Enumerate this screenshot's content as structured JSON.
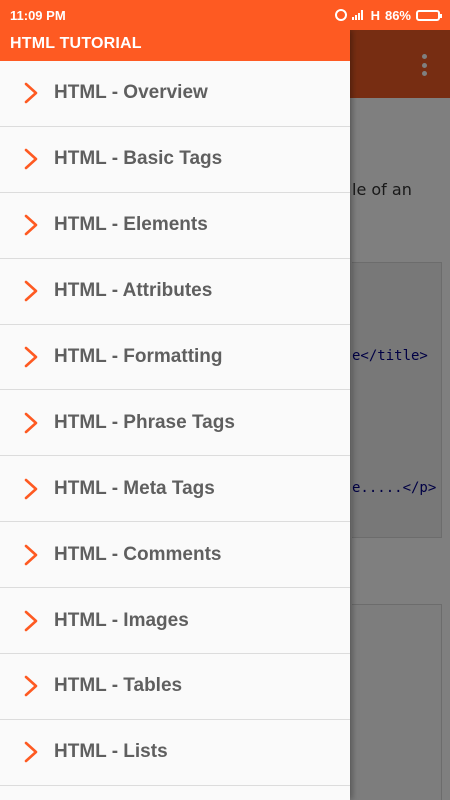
{
  "status_bar": {
    "time": "11:09 PM",
    "network": "H",
    "battery": "86%",
    "battery_level": 0.86
  },
  "app": {
    "title": "HTML TUTORIAL",
    "accent_color": "#fe5a22"
  },
  "background": {
    "text_fragment": "le of an",
    "code_line_1": "e</title>",
    "code_line_2": "e.....</p>"
  },
  "drawer": {
    "items": [
      {
        "label": "HTML - Overview",
        "icon": "chevron-right-icon"
      },
      {
        "label": "HTML - Basic Tags",
        "icon": "chevron-right-icon"
      },
      {
        "label": "HTML - Elements",
        "icon": "chevron-right-icon"
      },
      {
        "label": "HTML - Attributes",
        "icon": "chevron-right-icon"
      },
      {
        "label": "HTML - Formatting",
        "icon": "chevron-right-icon"
      },
      {
        "label": "HTML - Phrase Tags",
        "icon": "chevron-right-icon"
      },
      {
        "label": "HTML - Meta Tags",
        "icon": "chevron-right-icon"
      },
      {
        "label": "HTML - Comments",
        "icon": "chevron-right-icon"
      },
      {
        "label": "HTML - Images",
        "icon": "chevron-right-icon"
      },
      {
        "label": "HTML - Tables",
        "icon": "chevron-right-icon"
      },
      {
        "label": "HTML - Lists",
        "icon": "chevron-right-icon"
      }
    ]
  }
}
